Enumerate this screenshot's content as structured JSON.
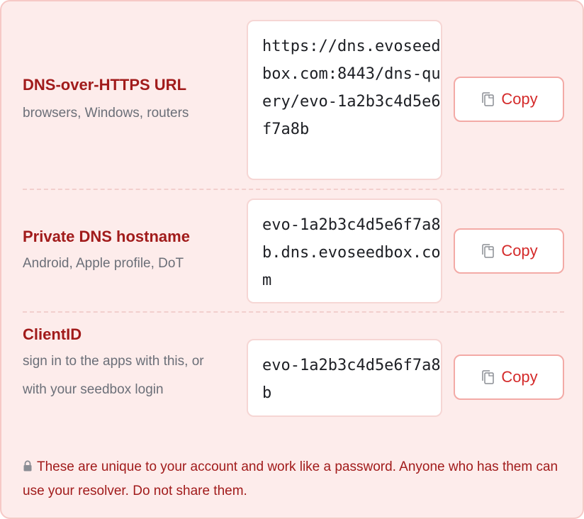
{
  "rows": [
    {
      "title": "DNS-over-HTTPS URL",
      "subtitle": "browsers, Windows, routers",
      "value": "https://dns.evoseedbox.com:8443/dns-query/evo-1a2b3c4d5e6f7a8b",
      "copy_label": "Copy",
      "copy_icon": "copy-icon"
    },
    {
      "title": "Private DNS hostname",
      "subtitle": "Android, Apple profile, DoT",
      "value": "evo-1a2b3c4d5e6f7a8b.dns.evoseedbox.com",
      "copy_label": "Copy",
      "copy_icon": "copy-icon"
    },
    {
      "title": "ClientID",
      "subtitle": "sign in to the apps with this, or with your seedbox login",
      "value": "evo-1a2b3c4d5e6f7a8b",
      "copy_label": "Copy",
      "copy_icon": "copy-icon"
    }
  ],
  "warning": {
    "icon": "lock-icon",
    "text": "These are unique to your account and work like a password. Anyone who has them can use your resolver. Do not share them."
  },
  "colors": {
    "card_bg": "#fdeceb",
    "title": "#a11b1b",
    "copy_text": "#d42a2a",
    "subtitle": "#6b6f78"
  }
}
